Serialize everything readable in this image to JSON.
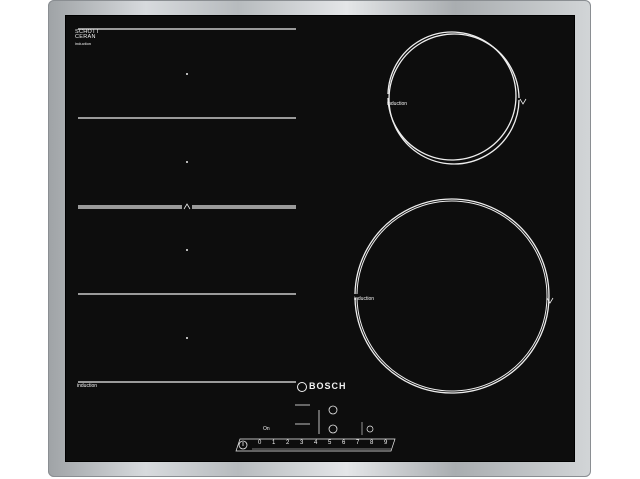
{
  "cooktop": {
    "glass_brand_line1": "SCHOTT",
    "glass_brand_line2": "CERAN",
    "glass_brand_line3": "induction",
    "zone_label_flex": "induction",
    "zone_label_small": "induction",
    "zone_label_large": "induction",
    "brand": "BOSCH",
    "controls": {
      "left_label": "On",
      "scale_digits": [
        "0",
        "1",
        "2",
        "3",
        "4",
        "5",
        "6",
        "7",
        "8",
        "9"
      ]
    }
  },
  "colors": {
    "glass": "#0d0d0d",
    "markings": "#f2f2f2",
    "frame": "stainless steel"
  }
}
